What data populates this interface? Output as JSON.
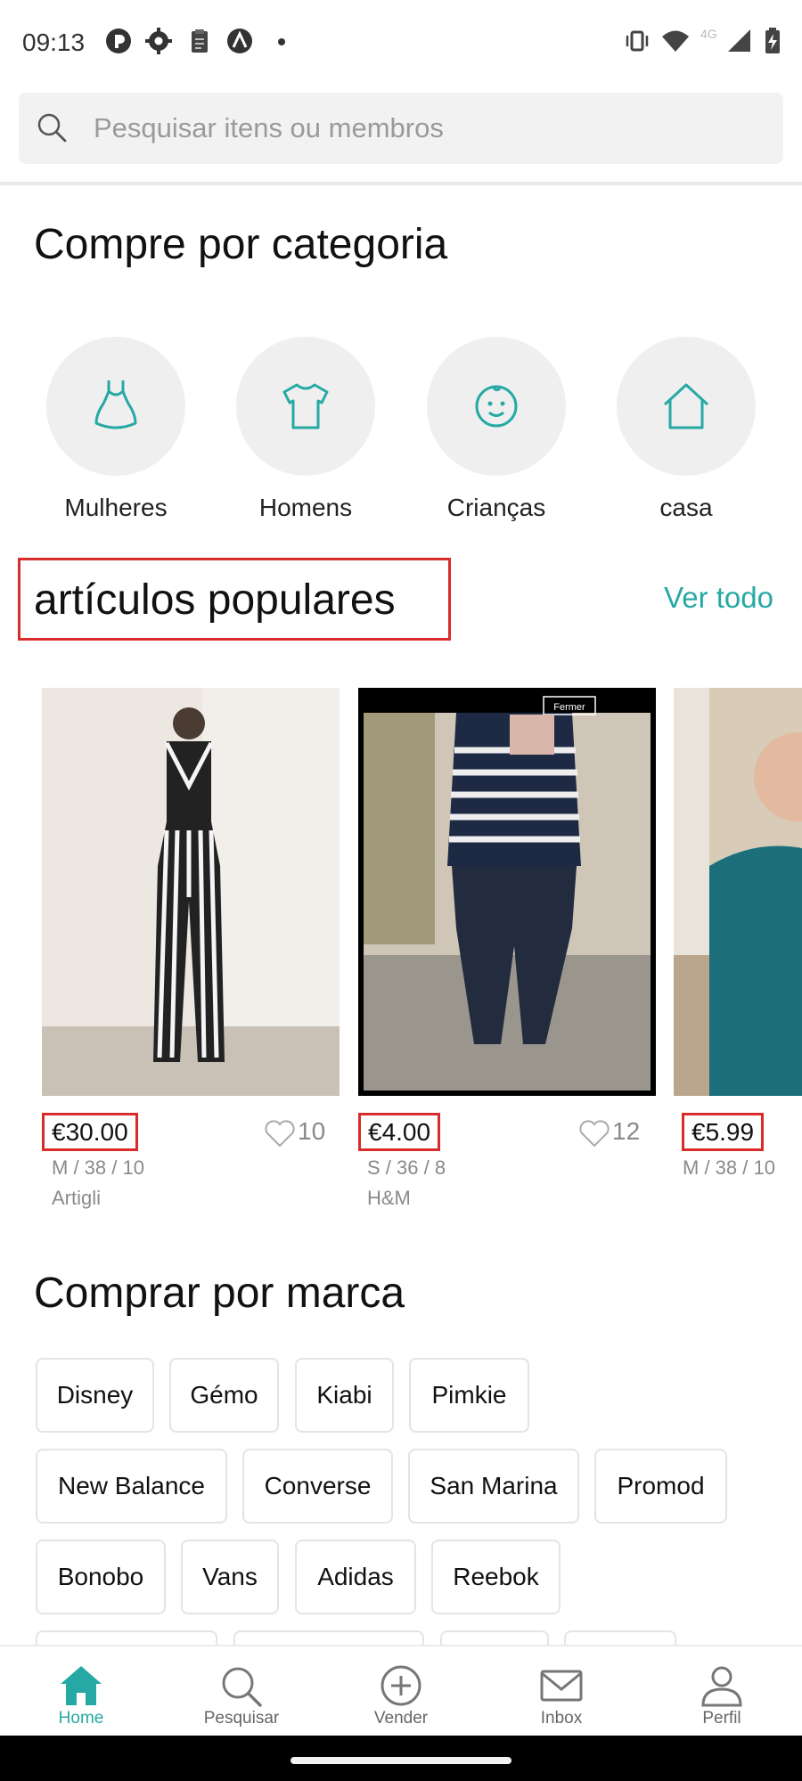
{
  "status_bar": {
    "time": "09:13"
  },
  "search": {
    "placeholder": "Pesquisar itens ou membros"
  },
  "categories_section": {
    "title": "Compre por categoria",
    "items": [
      {
        "label": "Mulheres",
        "icon": "dress-icon"
      },
      {
        "label": "Homens",
        "icon": "tshirt-icon"
      },
      {
        "label": "Crianças",
        "icon": "baby-face-icon"
      },
      {
        "label": "casa",
        "icon": "house-icon"
      }
    ]
  },
  "popular_section": {
    "title": "artículos populares",
    "see_all": "Ver todo",
    "items": [
      {
        "price": "€30.00",
        "likes": "10",
        "details": "M / 38 / 10",
        "brand": "Artigli"
      },
      {
        "price": "€4.00",
        "likes": "12",
        "details": "S / 36 / 8",
        "brand": "H&M",
        "overlay_text": "Fermer"
      },
      {
        "price": "€5.99",
        "details": "M / 38 / 10"
      }
    ]
  },
  "brands_section": {
    "title": "Comprar por marca",
    "brands": [
      "Disney",
      "Gémo",
      "Kiabi",
      "Pimkie",
      "New Balance",
      "Converse",
      "San Marina",
      "Promod",
      "Bonobo",
      "Vans",
      "Adidas",
      "Reebok"
    ]
  },
  "bottom_nav": {
    "items": [
      {
        "label": "Home",
        "icon": "home-icon",
        "active": true
      },
      {
        "label": "Pesquisar",
        "icon": "search-icon"
      },
      {
        "label": "Vender",
        "icon": "plus-circle-icon"
      },
      {
        "label": "Inbox",
        "icon": "mail-icon"
      },
      {
        "label": "Perfil",
        "icon": "person-icon"
      }
    ]
  },
  "colors": {
    "accent": "#26a9a4",
    "highlight_box": "#d92b2b"
  }
}
